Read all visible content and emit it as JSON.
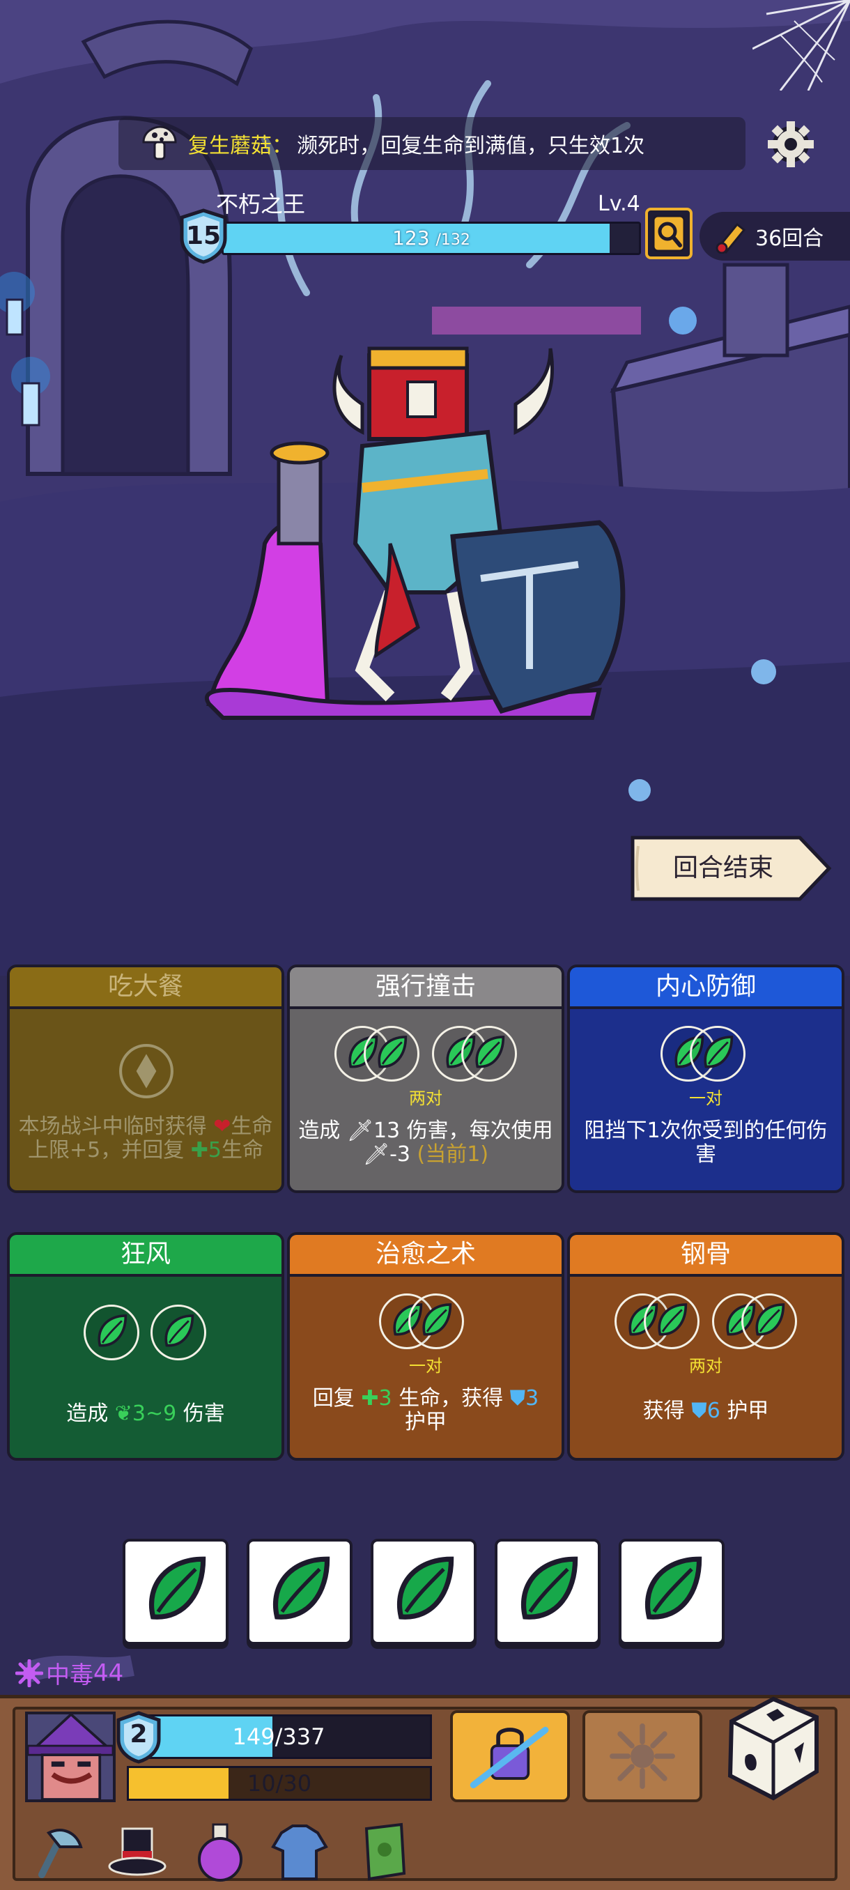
{
  "relic": {
    "name": "复生蘑菇",
    "separator": "：",
    "description": "濒死时，回复生命到满值，只生效1次"
  },
  "enemy": {
    "name": "不朽之王",
    "level": "Lv.4",
    "shield": "15",
    "hp_current": "123",
    "hp_max": "/132",
    "hp_fraction": 0.93
  },
  "rounds": "36回合",
  "end_turn_label": "回合结束",
  "cards": [
    {
      "title": "吃大餐",
      "theme": "disabled",
      "desc_parts": [
        "本场战斗中临时获得 ",
        "❤",
        "生命上限+5，并回复 ",
        "✚5",
        "生命"
      ]
    },
    {
      "title": "强行撞击",
      "theme": "gray",
      "slot_label": "两对",
      "desc_a": "造成 ",
      "desc_b": "13 伤害，每次使用",
      "desc_c": "-3",
      "desc_d": "(当前1)"
    },
    {
      "title": "内心防御",
      "theme": "blue",
      "slot_label": "一对",
      "desc": "阻挡下1次你受到的任何伤害"
    },
    {
      "title": "狂风",
      "theme": "green",
      "desc_a": "造成 ",
      "desc_b": "3~9",
      "desc_c": " 伤害"
    },
    {
      "title": "治愈之术",
      "theme": "orange",
      "slot_label": "一对",
      "desc_a": "回复 ",
      "desc_b": "✚3",
      "desc_c": " 生命，获得 ",
      "desc_d": "3",
      "desc_e": "护甲"
    },
    {
      "title": "钢骨",
      "theme": "orange",
      "slot_label": "两对",
      "desc_a": "获得 ",
      "desc_b": "6",
      "desc_c": " 护甲"
    }
  ],
  "dice_count": 5,
  "status": {
    "name": "中毒",
    "value": "44"
  },
  "player": {
    "shield": "2",
    "hp_text": "149/337",
    "hp_fraction": 0.44,
    "xp_text": "10/30",
    "xp_fraction": 0.33
  },
  "icons": {
    "relic": "mushroom-icon",
    "settings": "gear-icon",
    "intent": "magnifier-icon",
    "rounds": "scroll-icon",
    "die_face": "green-leaf-icon",
    "status": "poison-splat-icon",
    "ability_1": "locked-sword-icon",
    "ability_2": "spikes-icon",
    "reroll": "white-dice-icon"
  },
  "colors": {
    "green_accent": "#39d05a",
    "blue_accent": "#52b6f5",
    "gold_accent": "#f3e033",
    "poison": "#c35cf2"
  }
}
